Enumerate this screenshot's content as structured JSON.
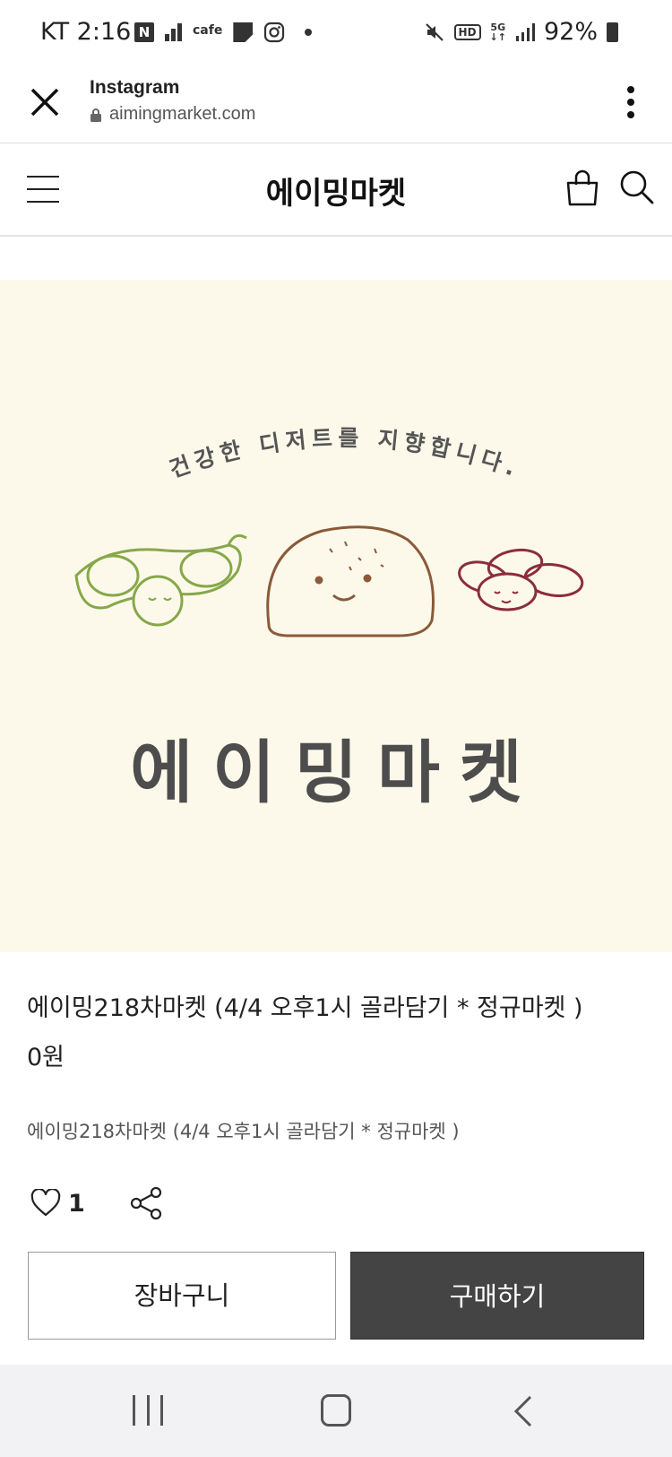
{
  "status_bar": {
    "carrier_time": "KT 2:16",
    "cafe_label": "cafe",
    "n_label": "N",
    "hd_label": "HD",
    "network_label": "5G",
    "battery": "92%"
  },
  "browser": {
    "title": "Instagram",
    "url": "aimingmarket.com"
  },
  "header": {
    "brand": "에이밍마켓"
  },
  "product_image": {
    "slogan": "건강한 디저트를 지향합니다.",
    "logo_text": "에이밍마켓",
    "colors": {
      "background": "#fdf9ea",
      "pea": "#86a84a",
      "bread": "#8a5a3a",
      "beans": "#8c2d3c",
      "logo": "#4d4d4d"
    }
  },
  "product": {
    "title": "에이밍218차마켓 (4/4 오후1시 골라담기 * 정규마켓 )",
    "price": "0원",
    "description": "에이밍218차마켓 (4/4 오후1시 골라담기 * 정규마켓 )",
    "like_count": "1"
  },
  "buttons": {
    "cart": "장바구니",
    "buy": "구매하기"
  },
  "icons": {
    "close": "close-icon",
    "lock": "lock-icon",
    "more": "more-vertical-icon",
    "menu": "menu-icon",
    "bag": "shopping-bag-icon",
    "search": "search-icon",
    "heart": "heart-icon",
    "share": "share-icon"
  }
}
